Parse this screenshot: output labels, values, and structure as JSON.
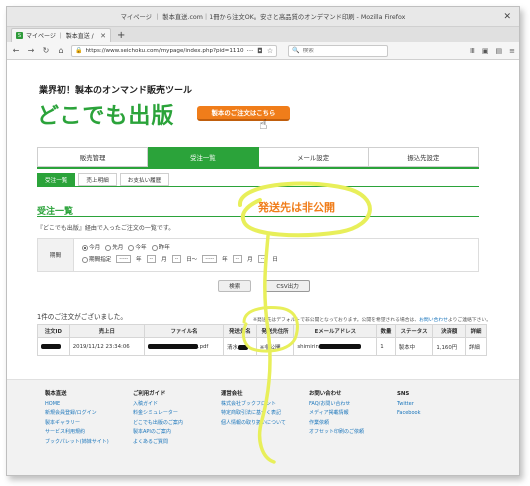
{
  "window": {
    "title": "マイページ ｜ 製本直送.com｜1冊から注文OK。安さと高品質のオンデマンド印刷 - Mozilla Firefox"
  },
  "browser": {
    "tab_label": "マイページ ｜ 製本直送 /",
    "url": "https://www.seichoku.com/mypage/index.php?pid=1110",
    "search_placeholder": "検索"
  },
  "header": {
    "tagline": "業界初！製本のオンマンド販売ツール",
    "brand": "どこでも出版",
    "order_button": "製本のご注文はこちら"
  },
  "main_nav": [
    {
      "label": "販売管理",
      "active": false
    },
    {
      "label": "受注一覧",
      "active": true
    },
    {
      "label": "メール設定",
      "active": false
    },
    {
      "label": "振込先設定",
      "active": false
    }
  ],
  "sub_nav": [
    {
      "label": "受注一覧",
      "active": true
    },
    {
      "label": "売上明細",
      "active": false
    },
    {
      "label": "お支払い履歴",
      "active": false
    }
  ],
  "section": {
    "title": "受注一覧",
    "description": "『どこでも出版』経由で入ったご注文の一覧です。"
  },
  "filter": {
    "label": "期間",
    "options": [
      "今月",
      "先月",
      "今年",
      "昨年"
    ],
    "custom_label": "期間指定",
    "year_sel": "-----",
    "month_sel": "--",
    "day_sel": "--",
    "unit_year": "年",
    "unit_month": "月",
    "unit_day_from": "日～",
    "unit_day_to": "日"
  },
  "buttons": {
    "search": "検索",
    "csv": "CSV出力"
  },
  "results": {
    "count_text": "1件のご注文がございました。",
    "note_prefix": "※発送先はデフォルトで非公開となっております。公開を希望される場合は、",
    "note_link": "お問い合わせ",
    "note_suffix": "よりご連絡下さい。"
  },
  "table": {
    "headers": [
      "注文ID",
      "売上日",
      "ファイル名",
      "発送先名",
      "発送先住所",
      "Eメールアドレス",
      "数量",
      "ステータス",
      "決済額",
      "詳細"
    ],
    "rows": [
      {
        "date": "2019/11/12 23:34:06",
        "file_ext": ".pdf",
        "ship_name": "清水",
        "address": "※非公開",
        "email": "shimirin",
        "qty": "1",
        "status": "製本中",
        "amount": "1,160円",
        "detail": "詳細"
      }
    ]
  },
  "footer": {
    "columns": [
      {
        "heading": "製本直送",
        "links": [
          "HOME",
          "新規会員登録/ログイン",
          "製本ギャラリー",
          "サービス利用規約",
          "ブックパレット(姉妹サイト)"
        ]
      },
      {
        "heading": "ご利用ガイド",
        "links": [
          "入稿ガイド",
          "料金シミュレーター",
          "どこでも出版のご案内",
          "製本APIのご案内",
          "よくあるご質問"
        ]
      },
      {
        "heading": "運営会社",
        "links": [
          "株式会社ブックフロント",
          "特定商取引法に基づく表記",
          "個人情報の取り扱いについて"
        ]
      },
      {
        "heading": "お問い合わせ",
        "links": [
          "FAQ/お問い合わせ",
          "メディア掲載情報",
          "作業依頼",
          "オフセット印刷のご依頼"
        ]
      },
      {
        "heading": "SNS",
        "links": [
          "Twitter",
          "Facebook"
        ]
      }
    ]
  },
  "annotation": {
    "text": "発送先は非公開",
    "color": "#f07d1a",
    "highlight_color": "#e8ef5a"
  }
}
